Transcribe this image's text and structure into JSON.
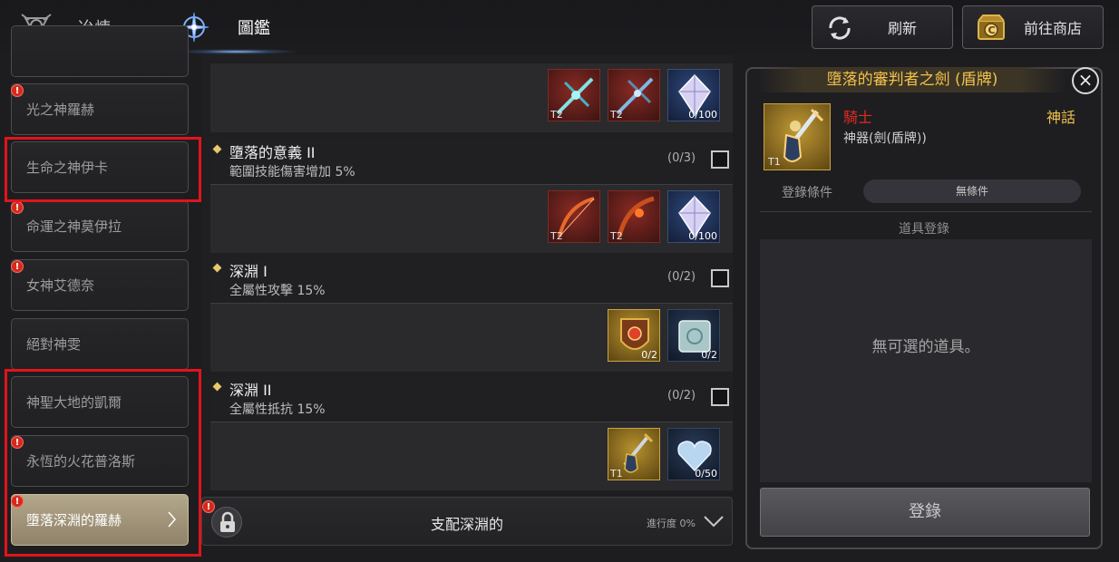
{
  "header": {
    "tabs": [
      {
        "label": "冶煉",
        "icon": "smelting-emblem-icon",
        "active": false
      },
      {
        "label": "圖鑑",
        "icon": "codex-compass-icon",
        "active": true
      }
    ],
    "refresh_label": "刷新",
    "shop_label": "前往商店"
  },
  "sidebar": {
    "items": [
      {
        "label": "",
        "alert": false
      },
      {
        "label": "光之神羅赫",
        "alert": true
      },
      {
        "label": "生命之神伊卡",
        "alert": false
      },
      {
        "label": "命運之神莫伊拉",
        "alert": true
      },
      {
        "label": "女神艾德奈",
        "alert": true
      },
      {
        "label": "絕對神雯",
        "alert": false
      },
      {
        "label": "神聖大地的凱爾",
        "alert": false
      },
      {
        "label": "永恆的火花普洛斯",
        "alert": true
      },
      {
        "label": "墮落深淵的羅赫",
        "alert": true,
        "active": true
      }
    ]
  },
  "effects": [
    {
      "items": [
        {
          "kind": "red",
          "tier": "T2",
          "qty": ""
        },
        {
          "kind": "red",
          "tier": "T2",
          "qty": ""
        },
        {
          "kind": "blue",
          "tier": "",
          "qty": "0/100"
        }
      ]
    },
    {
      "name": "墮落的意義 II",
      "desc": "範圍技能傷害增加 5%",
      "count": "(0/3)",
      "items": [
        {
          "kind": "red",
          "tier": "T2",
          "qty": ""
        },
        {
          "kind": "red",
          "tier": "T2",
          "qty": ""
        },
        {
          "kind": "blue",
          "tier": "",
          "qty": "0/100"
        }
      ]
    },
    {
      "name": "深淵 I",
      "desc": "全屬性攻擊 15%",
      "count": "(0/2)",
      "items": [
        {
          "kind": "gold",
          "tier": "",
          "qty": "0/2"
        },
        {
          "kind": "dark",
          "tier": "",
          "qty": "0/2"
        }
      ]
    },
    {
      "name": "深淵 II",
      "desc": "全屬性抵抗 15%",
      "count": "(0/2)",
      "items": [
        {
          "kind": "gold",
          "tier": "T1",
          "qty": ""
        },
        {
          "kind": "dark",
          "tier": "",
          "qty": "0/50"
        }
      ]
    }
  ],
  "collection_footer": {
    "title": "支配深淵的",
    "progress": "進行度 0%"
  },
  "detail": {
    "title": "墮落的審判者之劍 (盾牌)",
    "tier": "T1",
    "class": "騎士",
    "rarity": "神話",
    "type": "神器(劍(盾牌))",
    "condition_label": "登錄條件",
    "condition_value": "無條件",
    "register_section_label": "道具登錄",
    "empty_text": "無可選的道具。",
    "register_button": "登錄"
  },
  "colors": {
    "accent_gold": "#f2c14a",
    "class_red": "#e02b20",
    "alert_red": "#d42a1e",
    "highlight_box": "#e0141c"
  }
}
